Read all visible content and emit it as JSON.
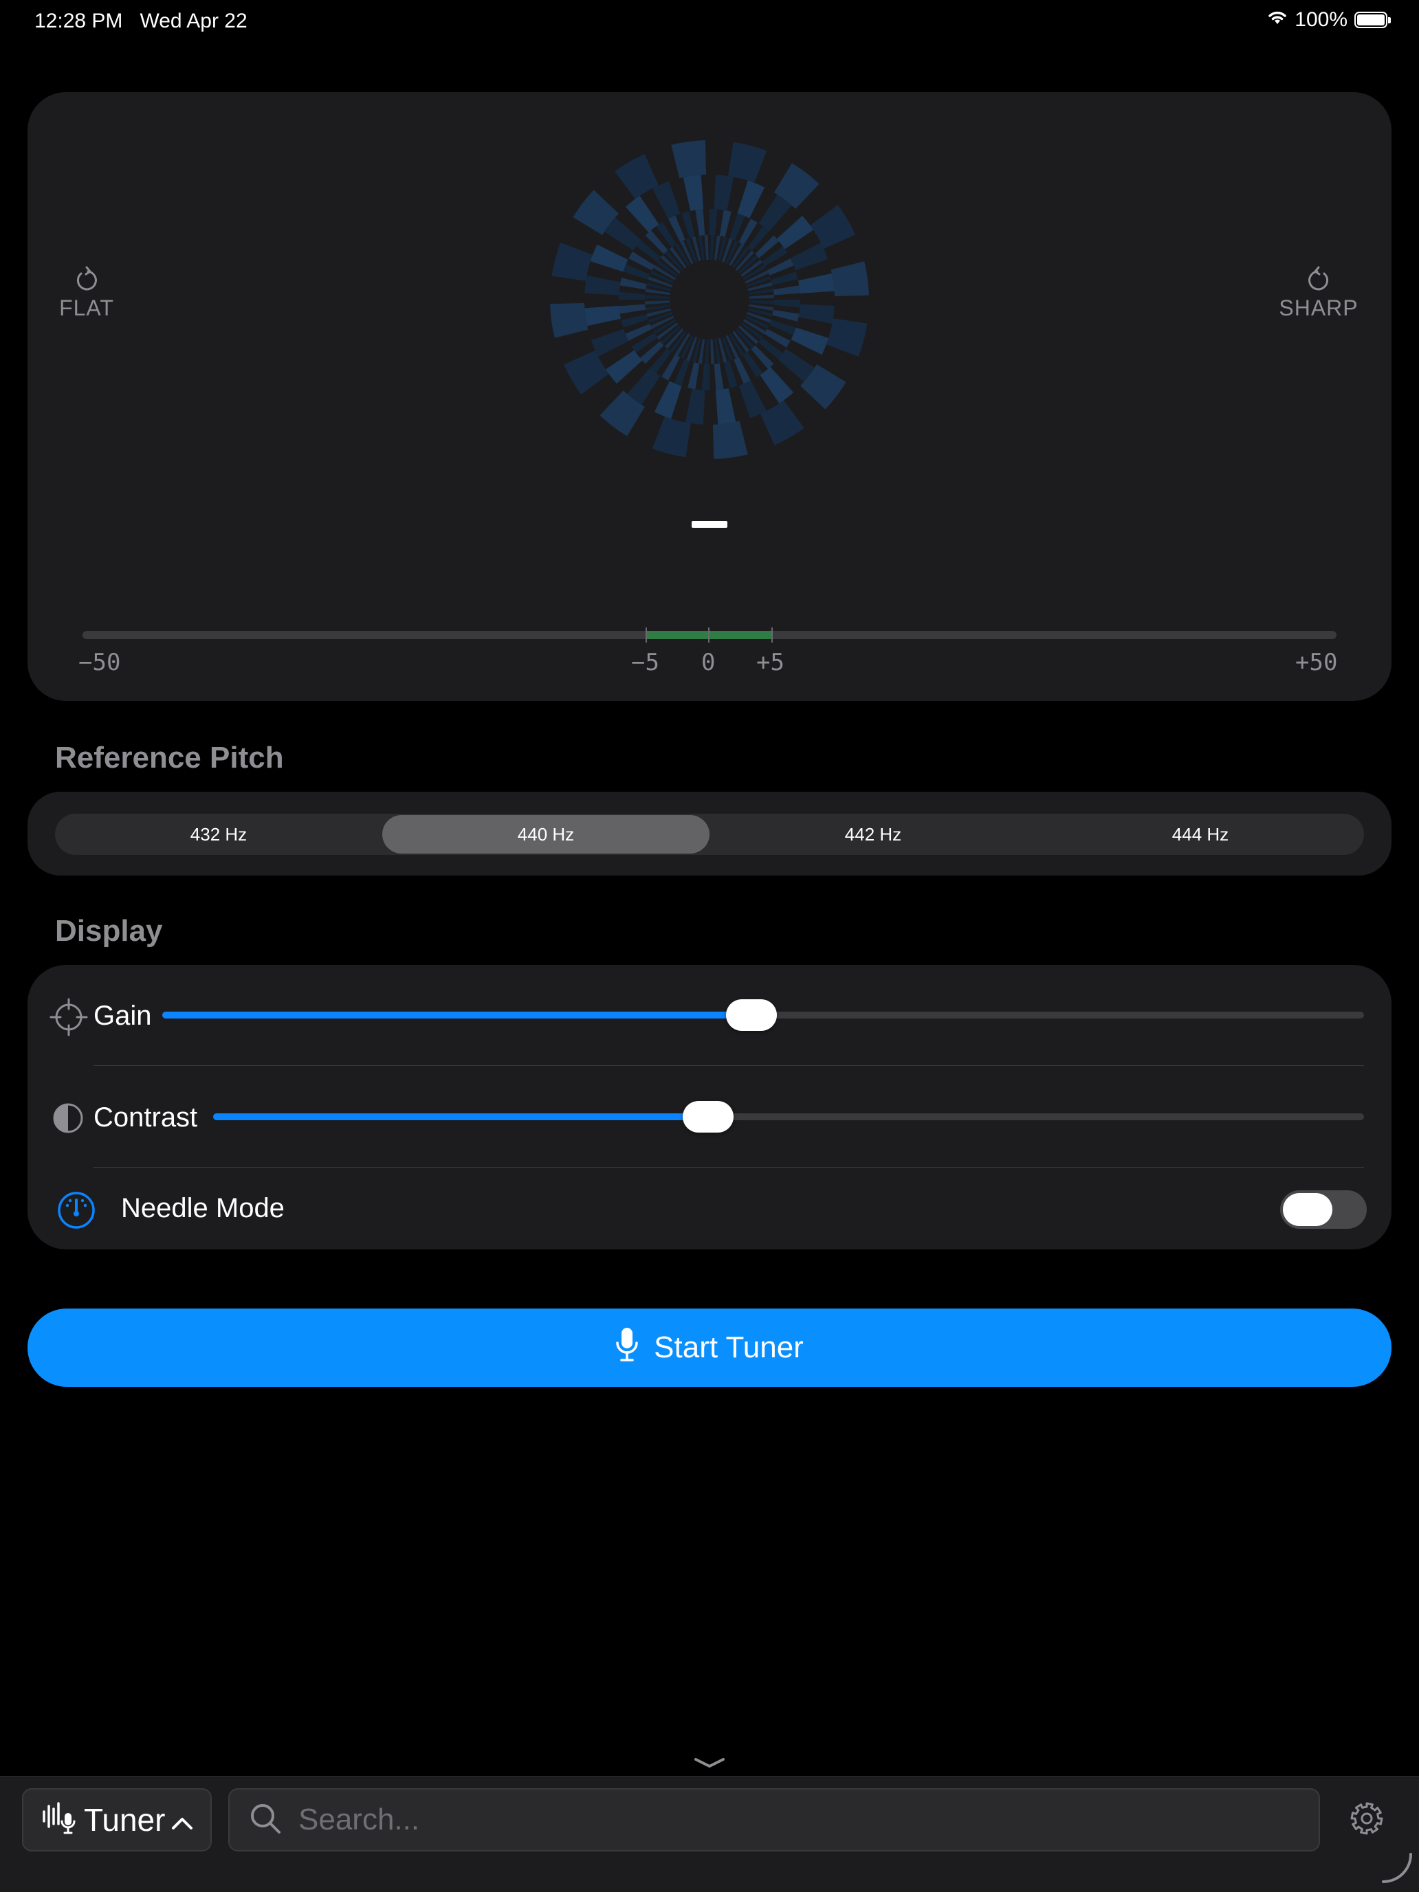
{
  "status_bar": {
    "time": "12:28 PM",
    "date": "Wed Apr 22",
    "battery": "100%"
  },
  "tuner": {
    "flat_label": "FLAT",
    "sharp_label": "SHARP",
    "note": "–",
    "scale": {
      "min": "−50",
      "minus5": "−5",
      "zero": "0",
      "plus5": "+5",
      "max": "+50"
    }
  },
  "reference_pitch": {
    "title": "Reference Pitch",
    "options": [
      "432 Hz",
      "440 Hz",
      "442 Hz",
      "444 Hz"
    ],
    "selected": "440 Hz"
  },
  "display": {
    "title": "Display",
    "gain": {
      "label": "Gain",
      "value": 0.49
    },
    "contrast": {
      "label": "Contrast",
      "value": 0.43
    },
    "needle_mode": {
      "label": "Needle Mode",
      "on": false
    }
  },
  "start_button": {
    "label": "Start Tuner"
  },
  "bottom_bar": {
    "tab_label": "Tuner",
    "search_placeholder": "Search..."
  },
  "colors": {
    "accent": "#0a84ff",
    "button": "#0a8ffe",
    "in_tune": "#2f7d45",
    "card": "#1c1c1e"
  }
}
